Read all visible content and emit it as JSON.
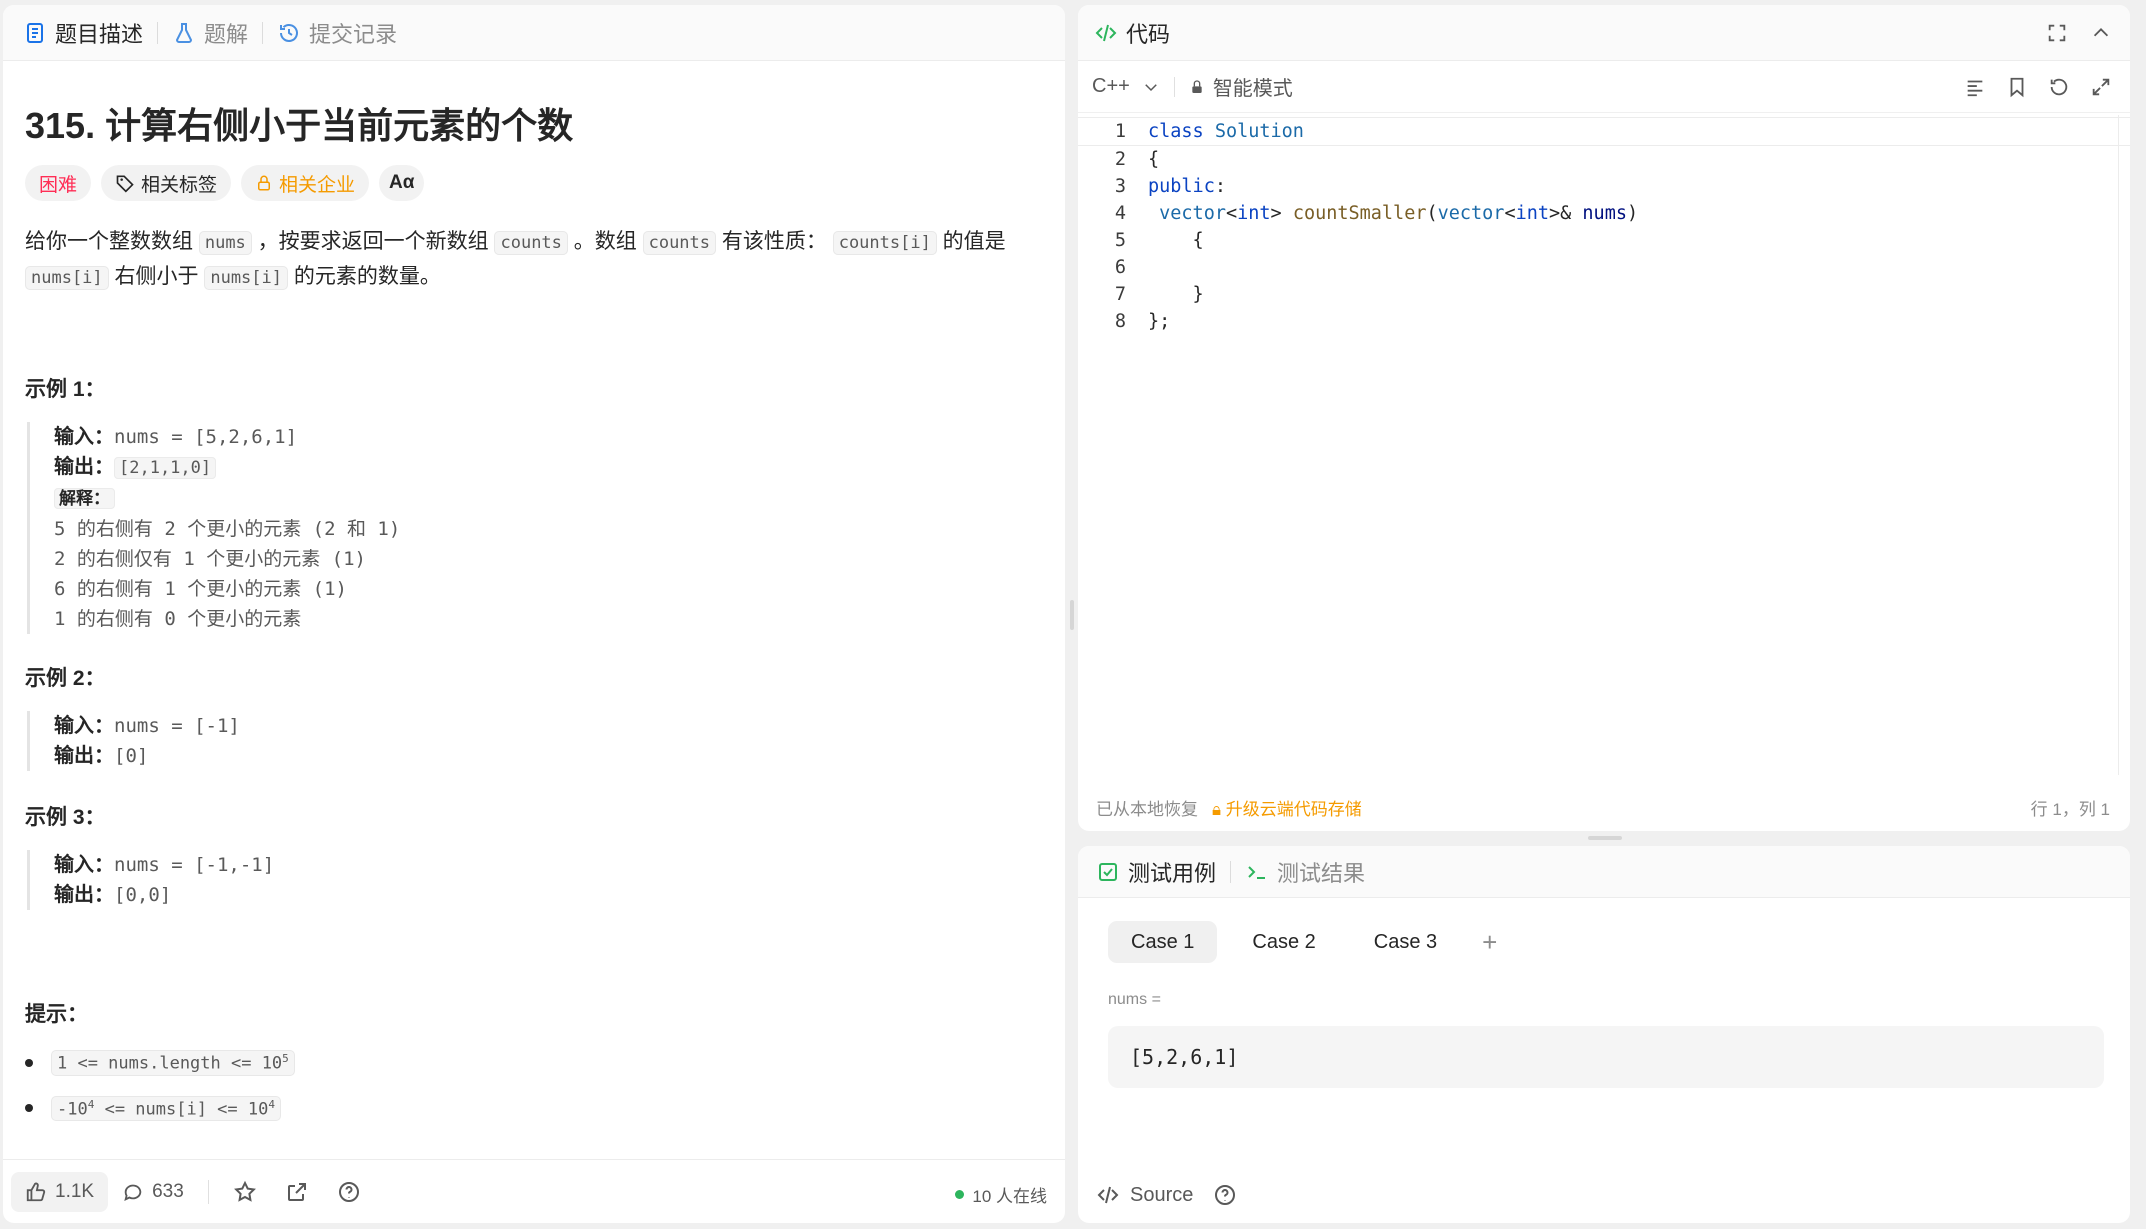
{
  "left_tabs": [
    {
      "label": "题目描述",
      "icon": "doc-icon"
    },
    {
      "label": "题解",
      "icon": "flask-icon"
    },
    {
      "label": "提交记录",
      "icon": "history-icon"
    }
  ],
  "problem": {
    "title": "315. 计算右侧小于当前元素的个数",
    "difficulty": "困难",
    "tags_label": "相关标签",
    "company_label": "相关企业"
  },
  "desc": {
    "p1": "给你一个整数数组",
    "nums": "nums",
    "p2": "，按要求返回一个新数组",
    "counts": "counts",
    "p3": "。数组",
    "p4": "有该性质：",
    "countsi": "counts[i]",
    "p5": "的值是",
    "numsi": "nums[i]",
    "p6": "右侧小于",
    "p7": "的元素的数量。"
  },
  "examples": [
    {
      "title": "示例 1：",
      "input_label": "输入：",
      "input": "nums = [5,2,6,1]",
      "output_label": "输出：",
      "output": "[2,1,1,0]",
      "explain_label": "解释：",
      "explain": [
        "5 的右侧有 2 个更小的元素 (2 和 1)",
        "2 的右侧仅有 1 个更小的元素 (1)",
        "6 的右侧有 1 个更小的元素 (1)",
        "1 的右侧有 0 个更小的元素"
      ]
    },
    {
      "title": "示例 2：",
      "input_label": "输入：",
      "input": "nums = [-1]",
      "output_label": "输出：",
      "output": "[0]"
    },
    {
      "title": "示例 3：",
      "input_label": "输入：",
      "input": "nums = [-1,-1]",
      "output_label": "输出：",
      "output": "[0,0]"
    }
  ],
  "hints": {
    "title": "提示：",
    "c1": "1 <= nums.length <= 10",
    "c1exp": "5",
    "c2a": "-10",
    "c2aexp": "4",
    "c2b": " <= nums[i] <= 10",
    "c2bexp": "4"
  },
  "footer": {
    "likes": "1.1K",
    "comments": "633",
    "online": "10 人在线"
  },
  "editor": {
    "title": "代码",
    "lang": "C++",
    "mode": "智能模式",
    "restored": "已从本地恢复",
    "upgrade": "升级云端代码存储",
    "cursor": "行 1，列 1",
    "lines": [
      [
        "1",
        "class Solution"
      ],
      [
        "2",
        "{"
      ],
      [
        "3",
        "public:"
      ],
      [
        "4",
        "    vector<int> countSmaller(vector<int>& nums)"
      ],
      [
        "5",
        "    {"
      ],
      [
        "6",
        ""
      ],
      [
        "7",
        "    }"
      ],
      [
        "8",
        "};"
      ]
    ]
  },
  "tests": {
    "tab1": "测试用例",
    "tab2": "测试结果",
    "cases": [
      "Case 1",
      "Case 2",
      "Case 3"
    ],
    "var_label": "nums =",
    "var_value": "[5,2,6,1]",
    "source": "Source"
  },
  "colors": {
    "hard": "#ff2d55",
    "company": "#f59b00",
    "accent": "#2db55d"
  }
}
